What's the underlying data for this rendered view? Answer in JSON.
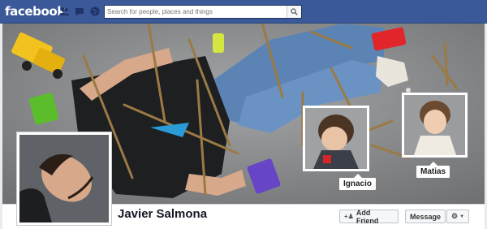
{
  "topbar": {
    "logo": "facebook",
    "jewels": [
      {
        "icon": "friend-requests-icon"
      },
      {
        "icon": "messages-icon"
      },
      {
        "icon": "notifications-globe-icon"
      }
    ],
    "search_placeholder": "Search for people, places and things",
    "search_button_icon": "magnifier-icon"
  },
  "profile": {
    "name": "Javier Salmona",
    "tags": [
      {
        "label": "Ignacio"
      },
      {
        "label": "Matias"
      }
    ]
  },
  "actions": {
    "add_friend": "Add Friend",
    "add_friend_icon": "add-person-icon",
    "message": "Message",
    "settings_icon": "gear-icon"
  },
  "colors": {
    "brand": "#3b5998",
    "cover_bg": "#8a8c8e"
  }
}
